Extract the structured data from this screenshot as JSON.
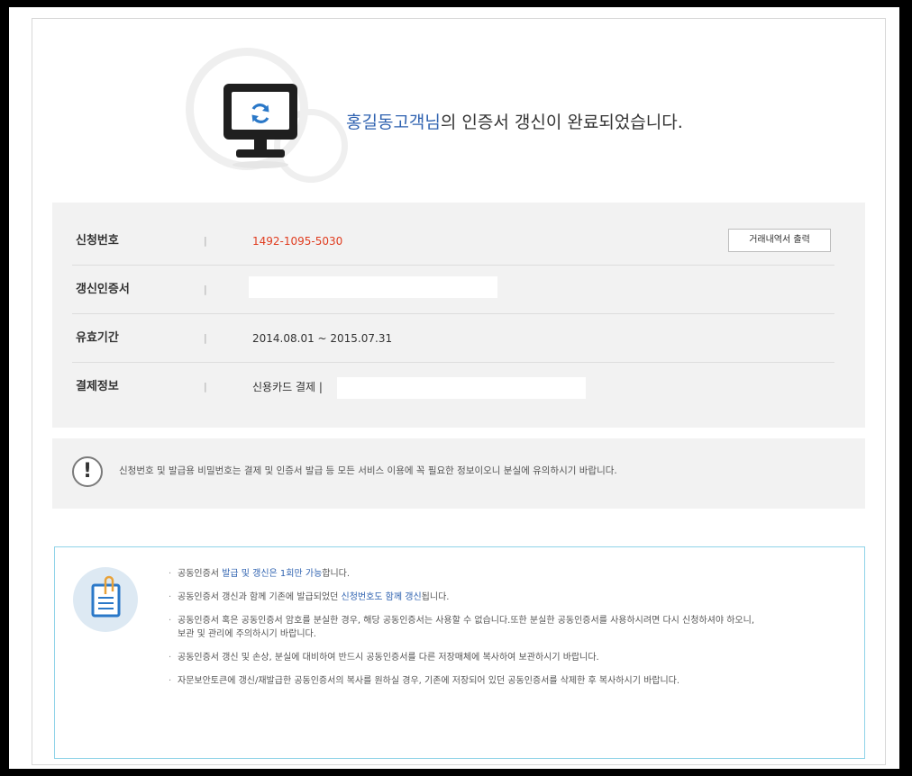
{
  "header": {
    "user_name": "홍길동고객님",
    "message_suffix": "의 인증서 갱신이 완료되었습니다."
  },
  "info": {
    "print_button": "거래내역서 출력",
    "rows": [
      {
        "label": "신청번호",
        "separator": "|",
        "value": "1492-1095-5030"
      },
      {
        "label": "갱신인증서",
        "separator": "|",
        "value": ""
      },
      {
        "label": "유효기간",
        "separator": "|",
        "value": "2014.08.01 ~ 2015.07.31"
      },
      {
        "label": "결제정보",
        "separator": "|",
        "value": "신용카드 결제 |"
      }
    ]
  },
  "notice": {
    "icon_symbol": "!",
    "text": "신청번호 및 발급용 비밀번호는 결제 및 인증서 발급 등 모든 서비스 이용에 꼭 필요한 정보이오니 분실에 유의하시기 바랍니다."
  },
  "guide": {
    "items": [
      {
        "pre": "공동인증서 ",
        "highlight": "발급 및 갱신은 1회만 가능",
        "post": "합니다."
      },
      {
        "pre": "공동인증서 갱신과 함께 기존에 발급되었던 ",
        "highlight": "신청번호도 함께 갱신",
        "post": "됩니다."
      },
      {
        "pre": "공동인증서 혹은 공동인증서 암호를 분실한 경우, 해당 공동인증서는 사용할 수 없습니다.또한 분실한 공동인증서를 사용하시려면 다시 신청하셔야 하오니, 보관 및 관리에 주의하시기 바랍니다.",
        "highlight": "",
        "post": ""
      },
      {
        "pre": "공동인증서 갱신 및 손상, 분실에 대비하여 반드시 공동인증서를 다른 저장매체에 복사하여 보관하시기 바랍니다.",
        "highlight": "",
        "post": ""
      },
      {
        "pre": "자문보안토큰에 갱신/재발급한 공동인증서의 복사를 원하실 경우, 기존에 저장되어 있던 공동인증서를 삭제한 후 복사하시기 바랍니다.",
        "highlight": "",
        "post": ""
      }
    ]
  },
  "colors": {
    "accent_blue": "#2f62b0",
    "number_red": "#e03c1f",
    "guide_border": "#8fd3e8"
  },
  "icons": {
    "header": "monitor-refresh-icon",
    "notice": "exclamation-icon",
    "guide": "clipboard-icon"
  }
}
